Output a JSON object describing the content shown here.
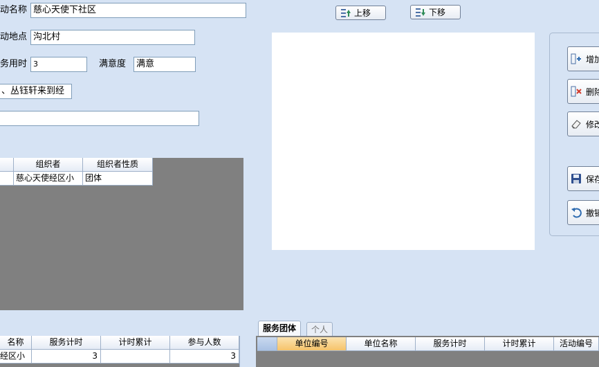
{
  "form": {
    "activity_name_label": "动名称",
    "activity_name_value": "慈心天使下社区",
    "activity_place_label": "动地点",
    "activity_place_value": "沟北村",
    "service_time_label": "务用时",
    "service_time_value": "3",
    "satisfaction_label": "满意度",
    "satisfaction_value": "满意",
    "participants_value": "、丛钰轩来到经",
    "extra_value": ""
  },
  "nav": {
    "up_label": "上移",
    "down_label": "下移"
  },
  "side_buttons": {
    "add": "增加",
    "delete": "删除",
    "edit": "修改",
    "save": "保存",
    "undo": "撤销"
  },
  "organizer_grid": {
    "headers": [
      "",
      "组织者",
      "组织者性质"
    ],
    "rows": [
      [
        "",
        "慈心天使经区小",
        "团体"
      ]
    ]
  },
  "bottom_left_grid": {
    "headers": [
      "名称",
      "服务计时",
      "计时累计",
      "参与人数"
    ],
    "rows": [
      [
        "经区小",
        "3",
        "",
        "3"
      ]
    ]
  },
  "tabs": {
    "team": "服务团体",
    "person": "个人"
  },
  "bottom_right_grid": {
    "headers": [
      "单位编号",
      "单位名称",
      "服务计时",
      "计时累计",
      "活动编号"
    ]
  }
}
